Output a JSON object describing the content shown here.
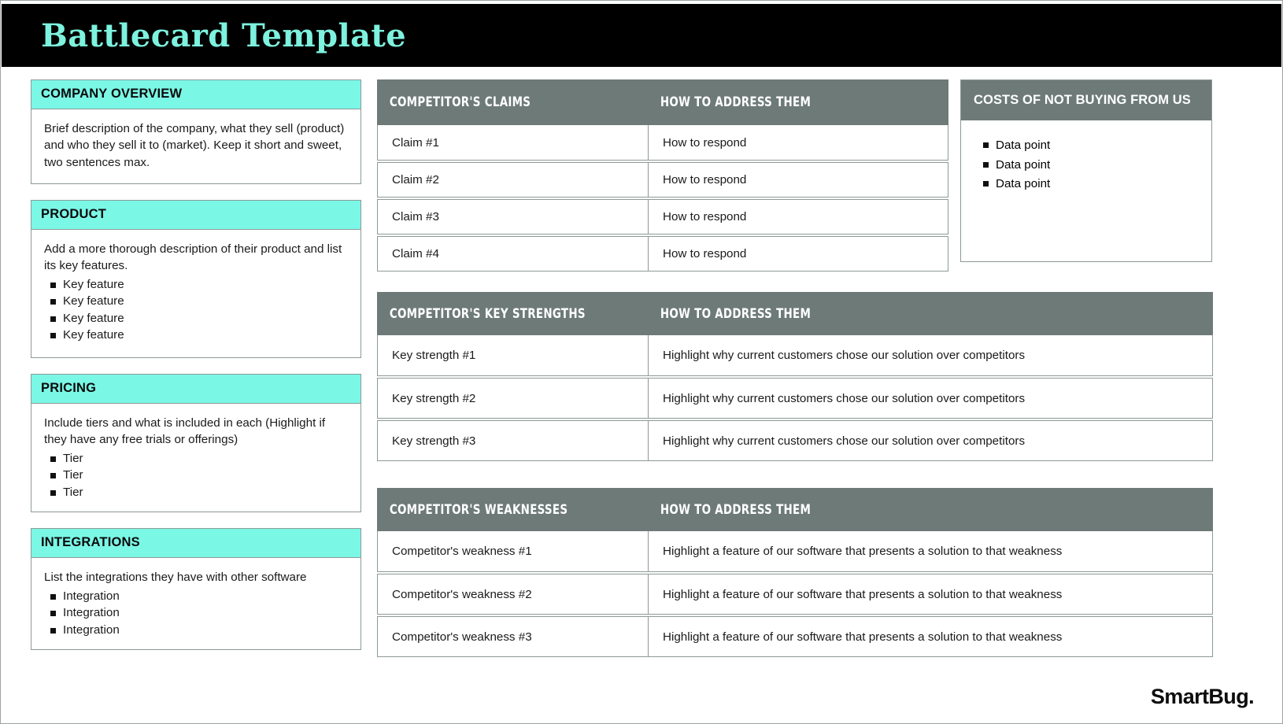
{
  "header": {
    "title": "Battlecard Template",
    "title_color": "#7df2de",
    "background_color": "#000000"
  },
  "theme": {
    "accent_teal": "#7bf7e6",
    "table_header_gray": "#6d7a78",
    "border_gray": "#8d9997"
  },
  "left_column": {
    "panels": [
      {
        "heading": "COMPANY OVERVIEW",
        "body": "Brief description of the company, what they sell (product) and who they sell it to (market). Keep it short and sweet, two sentences max.",
        "bullets": []
      },
      {
        "heading": "PRODUCT",
        "body": "Add a more thorough description of their product and list its key features.",
        "bullets": [
          "Key feature",
          "Key feature",
          "Key feature",
          "Key feature"
        ]
      },
      {
        "heading": "PRICING",
        "body": "Include tiers and what is included in each (Highlight if they have any free trials or offerings)",
        "bullets": [
          "Tier",
          "Tier",
          "Tier"
        ]
      },
      {
        "heading": "INTEGRATIONS",
        "body": "List the integrations they have with other software",
        "bullets": [
          "Integration",
          "Integration",
          "Integration"
        ]
      }
    ]
  },
  "claims_table": {
    "columns": [
      "COMPETITOR'S CLAIMS",
      "HOW TO ADDRESS THEM"
    ],
    "rows": [
      [
        "Claim #1",
        "How to respond"
      ],
      [
        "Claim #2",
        "How to respond"
      ],
      [
        "Claim #3",
        "How to respond"
      ],
      [
        "Claim #4",
        "How to respond"
      ]
    ]
  },
  "costs_panel": {
    "heading": "COSTS OF NOT BUYING FROM US",
    "bullets": [
      "Data point",
      "Data point",
      "Data point"
    ]
  },
  "strengths_table": {
    "columns": [
      "COMPETITOR'S KEY STRENGTHS",
      "HOW TO ADDRESS THEM"
    ],
    "rows": [
      [
        "Key strength #1",
        "Highlight why current customers chose our solution over competitors"
      ],
      [
        "Key strength #2",
        "Highlight why current  customers chose our solution over competitors"
      ],
      [
        "Key strength #3",
        "Highlight why current  customers chose our solution over competitors"
      ]
    ]
  },
  "weaknesses_table": {
    "columns": [
      "COMPETITOR'S WEAKNESSES",
      "HOW TO ADDRESS THEM"
    ],
    "rows": [
      [
        "Competitor's weakness #1",
        "Highlight a feature of our software that presents a solution to that weakness"
      ],
      [
        "Competitor's weakness #2",
        "Highlight a feature of our software that presents a solution to that weakness"
      ],
      [
        "Competitor's weakness #3",
        "Highlight a feature of our software that presents a solution to that weakness"
      ]
    ]
  },
  "footer": {
    "logo_text": "SmartBug."
  }
}
